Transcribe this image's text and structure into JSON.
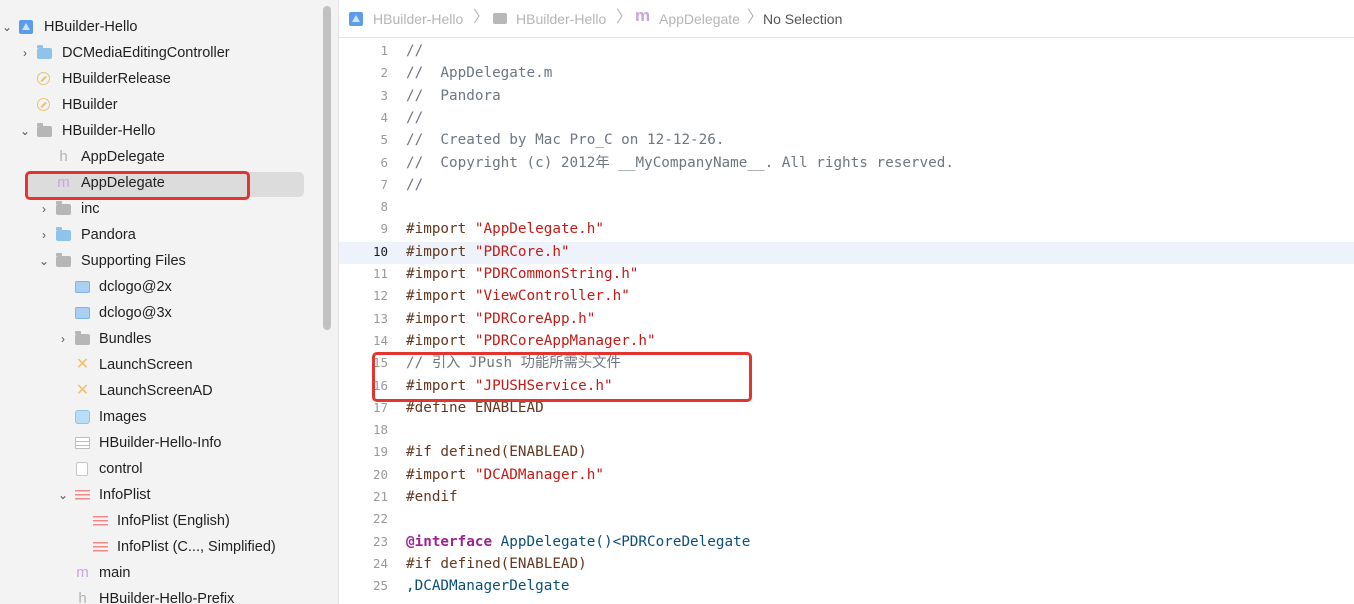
{
  "sidebar": {
    "items": [
      {
        "label": "HBuilder-Hello",
        "icon": "project-icon",
        "chevron": "down"
      },
      {
        "label": "DCMediaEditingController",
        "icon": "folder-blue-icon",
        "chevron": "right"
      },
      {
        "label": "HBuilderRelease",
        "icon": "target-icon",
        "chevron": ""
      },
      {
        "label": "HBuilder",
        "icon": "target-icon",
        "chevron": ""
      },
      {
        "label": "HBuilder-Hello",
        "icon": "folder-icon",
        "chevron": "down"
      },
      {
        "label": "AppDelegate",
        "icon": "header-file-icon",
        "chevron": ""
      },
      {
        "label": "AppDelegate",
        "icon": "objc-file-icon",
        "chevron": "",
        "selected": true
      },
      {
        "label": "inc",
        "icon": "folder-icon",
        "chevron": "right"
      },
      {
        "label": "Pandora",
        "icon": "folder-blue-icon",
        "chevron": "right"
      },
      {
        "label": "Supporting Files",
        "icon": "folder-icon",
        "chevron": "down"
      },
      {
        "label": "dclogo@2x",
        "icon": "image-icon",
        "chevron": ""
      },
      {
        "label": "dclogo@3x",
        "icon": "image-icon",
        "chevron": ""
      },
      {
        "label": "Bundles",
        "icon": "folder-icon",
        "chevron": "right"
      },
      {
        "label": "LaunchScreen",
        "icon": "storyboard-icon",
        "chevron": ""
      },
      {
        "label": "LaunchScreenAD",
        "icon": "storyboard-icon",
        "chevron": ""
      },
      {
        "label": "Images",
        "icon": "asset-catalog-icon",
        "chevron": ""
      },
      {
        "label": "HBuilder-Hello-Info",
        "icon": "plist-table-icon",
        "chevron": ""
      },
      {
        "label": "control",
        "icon": "document-icon",
        "chevron": ""
      },
      {
        "label": "InfoPlist",
        "icon": "strings-file-icon",
        "chevron": "down"
      },
      {
        "label": "InfoPlist (English)",
        "icon": "strings-file-icon",
        "chevron": ""
      },
      {
        "label": "InfoPlist (C..., Simplified)",
        "icon": "strings-file-icon",
        "chevron": ""
      },
      {
        "label": "main",
        "icon": "objc-file-icon",
        "chevron": ""
      },
      {
        "label": "HBuilder-Hello-Prefix",
        "icon": "header-file-icon",
        "chevron": ""
      }
    ]
  },
  "jumpbar": {
    "crumbs": [
      "HBuilder-Hello",
      "HBuilder-Hello",
      "AppDelegate",
      "No Selection"
    ],
    "separator": "〉",
    "icons": [
      "project-icon",
      "folder-icon",
      "objc-file-icon"
    ]
  },
  "editor": {
    "active_line": 10,
    "lines": [
      {
        "n": "1",
        "text": "//"
      },
      {
        "n": "2",
        "text": "//  AppDelegate.m"
      },
      {
        "n": "3",
        "text": "//  Pandora"
      },
      {
        "n": "4",
        "text": "//"
      },
      {
        "n": "5",
        "text": "//  Created by Mac Pro_C on 12-12-26."
      },
      {
        "n": "6",
        "text": "//  Copyright (c) 2012年 __MyCompanyName__. All rights reserved."
      },
      {
        "n": "7",
        "text": "//"
      },
      {
        "n": "8",
        "text": ""
      },
      {
        "n": "9",
        "text": "#import \"AppDelegate.h\""
      },
      {
        "n": "10",
        "text": "#import \"PDRCore.h\""
      },
      {
        "n": "11",
        "text": "#import \"PDRCommonString.h\""
      },
      {
        "n": "12",
        "text": "#import \"ViewController.h\""
      },
      {
        "n": "13",
        "text": "#import \"PDRCoreApp.h\""
      },
      {
        "n": "14",
        "text": "#import \"PDRCoreAppManager.h\""
      },
      {
        "n": "15",
        "text": "// 引入 JPush 功能所需头文件"
      },
      {
        "n": "16",
        "text": "#import \"JPUSHService.h\""
      },
      {
        "n": "17",
        "text": "#define ENABLEAD"
      },
      {
        "n": "18",
        "text": ""
      },
      {
        "n": "19",
        "text": "#if defined(ENABLEAD)"
      },
      {
        "n": "20",
        "text": "#import \"DCADManager.h\""
      },
      {
        "n": "21",
        "text": "#endif"
      },
      {
        "n": "22",
        "text": ""
      },
      {
        "n": "23",
        "text": "@interface AppDelegate()<PDRCoreDelegate"
      },
      {
        "n": "24",
        "text": "#if defined(ENABLEAD)"
      },
      {
        "n": "25",
        "text": ",DCADManagerDelgate"
      }
    ]
  },
  "colors": {
    "annotation": "#e3342f",
    "comment": "#6e7781",
    "string": "#c41a16",
    "preprocessor": "#643820",
    "keyword": "#9b2393",
    "selection": "#dcdcdc",
    "current_line": "#eef3fb"
  }
}
